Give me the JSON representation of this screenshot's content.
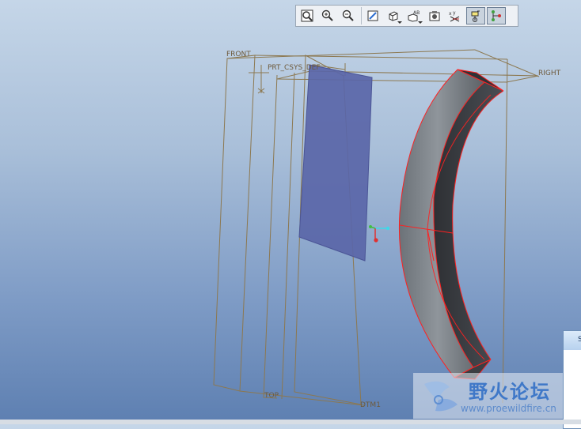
{
  "toolbar": {
    "buttons": [
      {
        "icon": "refit-icon"
      },
      {
        "icon": "zoom-in-icon"
      },
      {
        "icon": "zoom-out-icon"
      },
      {
        "icon": "repaint-icon"
      },
      {
        "icon": "display-style-icon"
      },
      {
        "icon": "saved-view-icon"
      },
      {
        "icon": "view-manager-icon"
      },
      {
        "icon": "datum-display-icon"
      },
      {
        "icon": "spin-center-icon"
      },
      {
        "icon": "annotation-display-icon"
      }
    ]
  },
  "model": {
    "datum_front": "FRONT",
    "datum_right": "RIGHT",
    "datum_top": "TOP",
    "datum_dtm1": "DTM1",
    "csys_label": "PRT_CSYS_DEF"
  },
  "colors": {
    "datum_plane": "#8c7850",
    "sketch_plane": "#5a66a8",
    "edge_highlight": "#ff2020",
    "solid_light": "#9aa0a6",
    "solid_dark": "#3a3d42"
  },
  "watermark": {
    "text": "野火论坛",
    "url": "www.proewildfire.cn"
  },
  "side_window": {
    "title": "S"
  }
}
